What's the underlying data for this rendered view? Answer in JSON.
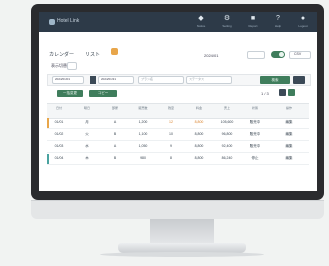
{
  "colors": {
    "bezel": "#2a2b2e",
    "header": "#2d3a48",
    "accent_green": "#3f7d5c",
    "accent_orange": "#e8a64a",
    "row_flag_teal": "#4aa3a0"
  },
  "header": {
    "brand_text": "Hotel Link",
    "nav": [
      {
        "icon": "bell-icon",
        "label": "Notice"
      },
      {
        "icon": "gear-icon",
        "label": "Setting"
      },
      {
        "icon": "chart-icon",
        "label": "Report"
      },
      {
        "icon": "help-icon",
        "label": "Help"
      },
      {
        "icon": "user-icon",
        "label": "Logout"
      }
    ]
  },
  "tabs": {
    "items": [
      "カレンダー",
      "リスト"
    ],
    "icon": "cart-icon"
  },
  "toolbar": {
    "view_label": "表示切替",
    "date_label": "2024/01",
    "export_label": "CSV"
  },
  "filters": {
    "date_from": "2024/01/01",
    "date_to": "2024/01/31",
    "plan_placeholder": "プラン名",
    "status_placeholder": "ステータス",
    "search_label": "検索"
  },
  "actions": {
    "bulk_label": "一括変更",
    "copy_label": "コピー",
    "page_text": "1 / 3"
  },
  "table": {
    "headers": [
      "日付",
      "曜日",
      "部屋",
      "販売数",
      "残室",
      "料金",
      "売上",
      "状態",
      "操作"
    ],
    "rows": [
      [
        "01/01",
        "月",
        "A",
        "1,200",
        "12",
        "8,800",
        "105,600",
        "販売中",
        "編集"
      ],
      [
        "01/02",
        "火",
        "B",
        "1,100",
        "10",
        "8,800",
        "96,800",
        "販売中",
        "編集"
      ],
      [
        "01/03",
        "水",
        "A",
        "1,050",
        "9",
        "8,800",
        "92,400",
        "販売中",
        "編集"
      ],
      [
        "01/04",
        "木",
        "B",
        "980",
        "8",
        "8,800",
        "86,240",
        "停止",
        "編集"
      ]
    ]
  }
}
